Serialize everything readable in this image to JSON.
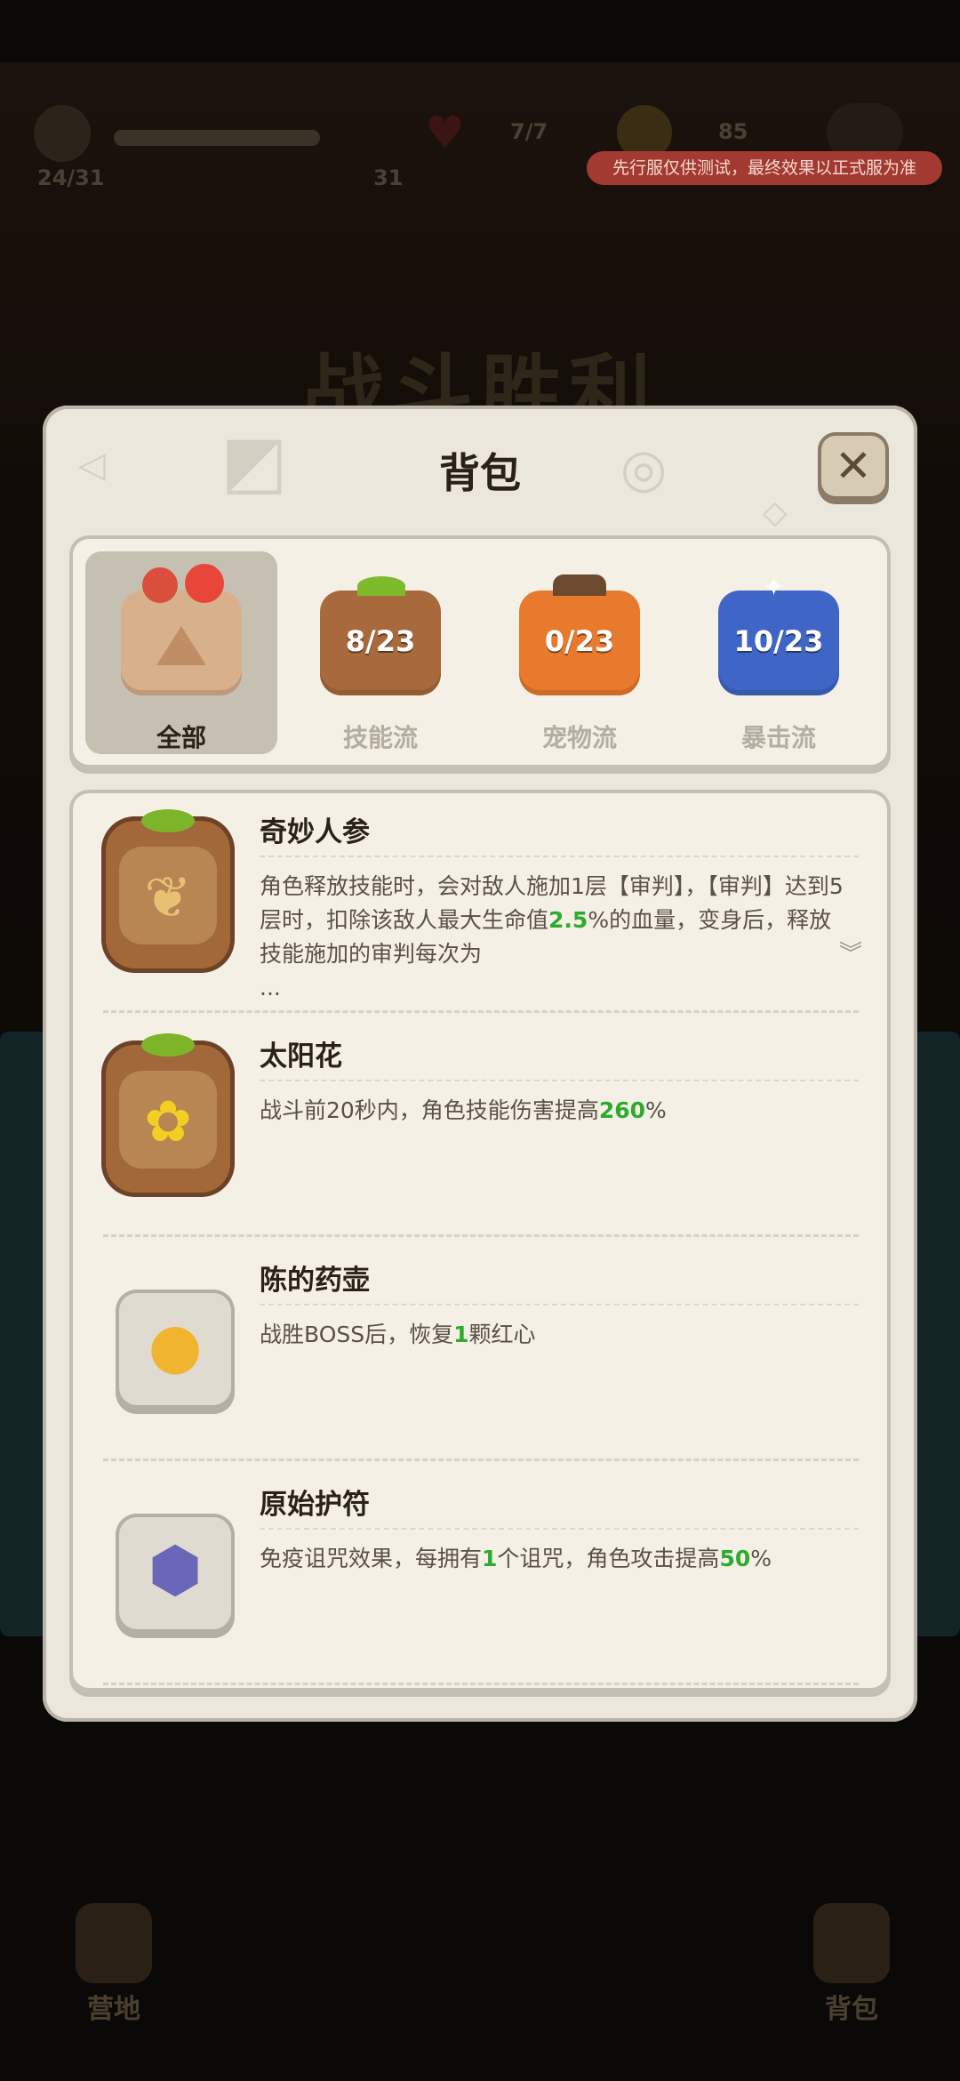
{
  "hud": {
    "progress": "24/31",
    "hp_value": "31",
    "lives": "7/7",
    "coins": "85",
    "test_banner": "先行服仅供测试，最终效果以正式服为准",
    "victory": "战斗胜利"
  },
  "panel": {
    "title": "背包",
    "close_icon": "close-icon"
  },
  "filters": [
    {
      "label": "全部",
      "count": "",
      "color": "#d9b08c",
      "active": true
    },
    {
      "label": "技能流",
      "count": "8/23",
      "color": "#a86a3c",
      "active": false
    },
    {
      "label": "宠物流",
      "count": "0/23",
      "color": "#e77a2c",
      "active": false
    },
    {
      "label": "暴击流",
      "count": "10/23",
      "color": "#3f66c6",
      "active": false
    }
  ],
  "items": [
    {
      "name": "奇妙人参",
      "icon": "ginseng-icon",
      "desc_parts": [
        "角色释放技能时，会对敌人施加1层【审判】，【审判】达到5层时，扣除该敌人最大生命值",
        "2.5",
        "%的血量，变身后，释放技能施加的审判每次为",
        "",
        "..."
      ]
    },
    {
      "name": "太阳花",
      "icon": "sunflower-icon",
      "desc_parts": [
        "战斗前20秒内，角色技能伤害提高",
        "260",
        "%"
      ]
    },
    {
      "name": "陈的药壶",
      "icon": "gourd-icon",
      "desc_parts": [
        "战胜BOSS后，恢复",
        "1",
        "颗红心"
      ]
    },
    {
      "name": "原始护符",
      "icon": "amulet-icon",
      "desc_parts": [
        "免疫诅咒效果，每拥有",
        "1",
        "个诅咒，角色攻击提高",
        "50",
        "%"
      ]
    }
  ],
  "bottom_nav": [
    {
      "label": "营地",
      "icon": "camp-icon"
    },
    {
      "label": "背包",
      "icon": "backpack-icon"
    }
  ]
}
